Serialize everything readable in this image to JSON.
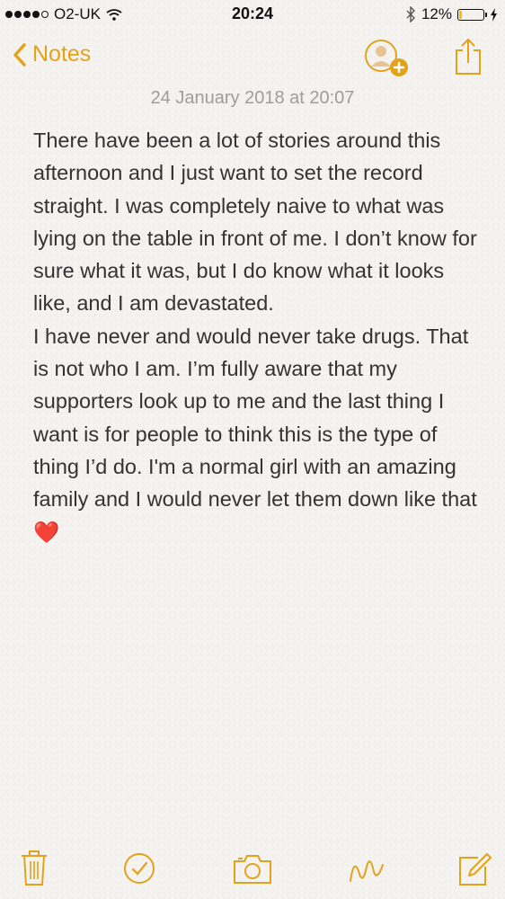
{
  "status_bar": {
    "carrier": "O2-UK",
    "time": "20:24",
    "battery_percent_label": "12%",
    "battery_level": 0.12
  },
  "nav": {
    "back_label": "Notes"
  },
  "note": {
    "date": "24 January 2018 at 20:07",
    "paragraph_1": "There have been a lot of stories around this afternoon and I just want to set the record straight. I was completely naive to what was lying on the table in front of me. I don’t know for sure what it was, but I do know what it looks like, and I am devastated.",
    "paragraph_2": "I have never and would never take drugs. That is not who I am. I’m fully aware that my supporters look up to me and the last thing I want is for people to think this is the type of thing I’d do. I'm a normal girl with an amazing family and I would never let them down like that",
    "emoji": "❤️"
  },
  "colors": {
    "accent": "#e3a21a",
    "text": "#333333",
    "date_text": "#9d9d9d",
    "heart": "#e0202c"
  },
  "icons": {
    "nav": [
      "chevron-left-icon",
      "add-person-icon",
      "share-icon"
    ],
    "toolbar": [
      "trash-icon",
      "checklist-icon",
      "camera-icon",
      "sketch-icon",
      "compose-icon"
    ]
  }
}
